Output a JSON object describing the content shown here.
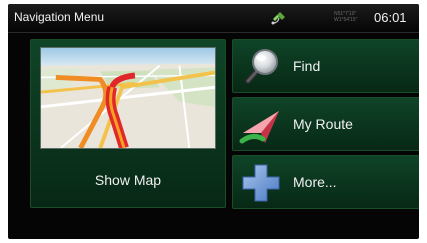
{
  "header": {
    "title": "Navigation Menu",
    "gps_info": "N51°7'19\" W1°54'15\"",
    "time": "06:01"
  },
  "main": {
    "map_tile": {
      "label": "Show Map"
    },
    "buttons": [
      {
        "label": "Find",
        "icon": "magnifier-icon"
      },
      {
        "label": "My Route",
        "icon": "route-arrow-icon"
      },
      {
        "label": "More...",
        "icon": "plus-icon"
      }
    ]
  },
  "colors": {
    "tile_green": "#0f4427",
    "tile_green_dark": "#072815",
    "route_red": "#e0282a",
    "route_orange": "#f39a1e"
  }
}
